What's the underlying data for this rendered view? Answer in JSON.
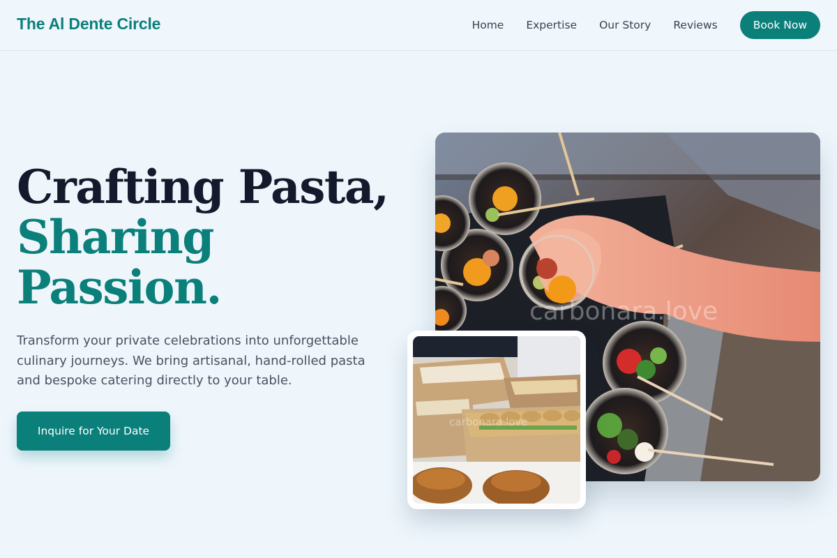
{
  "brand": {
    "name": "The Al Dente Circle"
  },
  "nav": {
    "links": [
      "Home",
      "Expertise",
      "Our Story",
      "Reviews"
    ],
    "cta_label": "Book Now"
  },
  "hero": {
    "title_line1": "Crafting Pasta,",
    "title_line2": "Sharing",
    "title_line3": "Passion.",
    "subtitle": "Transform your private celebrations into unforgettable culinary journeys. We bring artisanal, hand-rolled pasta and bespoke catering directly to your table.",
    "cta_label": "Inquire for Your Date"
  },
  "images": {
    "main_watermark": "carbonara.love",
    "thumb_watermark": "carbonara.love"
  },
  "colors": {
    "accent": "#0b7f7a",
    "background": "#eef6fc",
    "heading": "#141a2c"
  }
}
